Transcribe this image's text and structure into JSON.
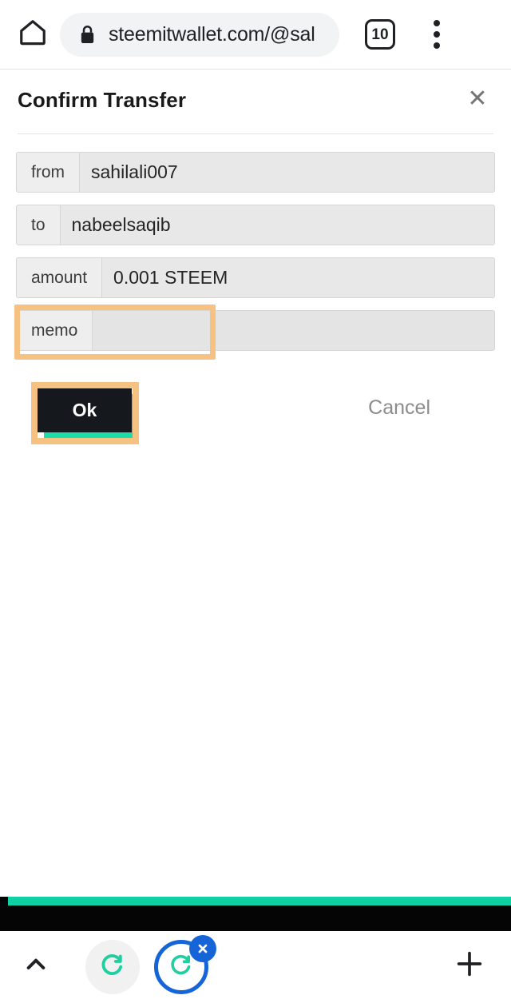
{
  "browser": {
    "home_icon": "home-icon",
    "lock_icon": "lock-icon",
    "url": "steemitwallet.com/@sal",
    "tab_count": "10",
    "menu_icon": "overflow-menu-icon"
  },
  "dialog": {
    "title": "Confirm Transfer",
    "close_icon": "✕",
    "fields": [
      {
        "label": "from",
        "value": "sahilali007",
        "name": "from"
      },
      {
        "label": "to",
        "value": "nabeelsaqib",
        "name": "to"
      },
      {
        "label": "amount",
        "value": "0.001 STEEM",
        "name": "amount"
      },
      {
        "label": "memo",
        "value": "",
        "name": "memo"
      }
    ],
    "ok_label": "Ok",
    "cancel_label": "Cancel",
    "highlight_color": "#f5c281",
    "ok_shadow_color": "#1ddbab"
  },
  "footer": {
    "accent_color": "#0fd2a4",
    "text": ""
  },
  "tabstrip": {
    "chevron_icon": "chevron-up-icon",
    "tab_inactive_icon": "steem-logo-icon",
    "tab_active_icon": "steem-logo-icon",
    "close_icon": "✕",
    "plus_icon": "plus-icon"
  }
}
